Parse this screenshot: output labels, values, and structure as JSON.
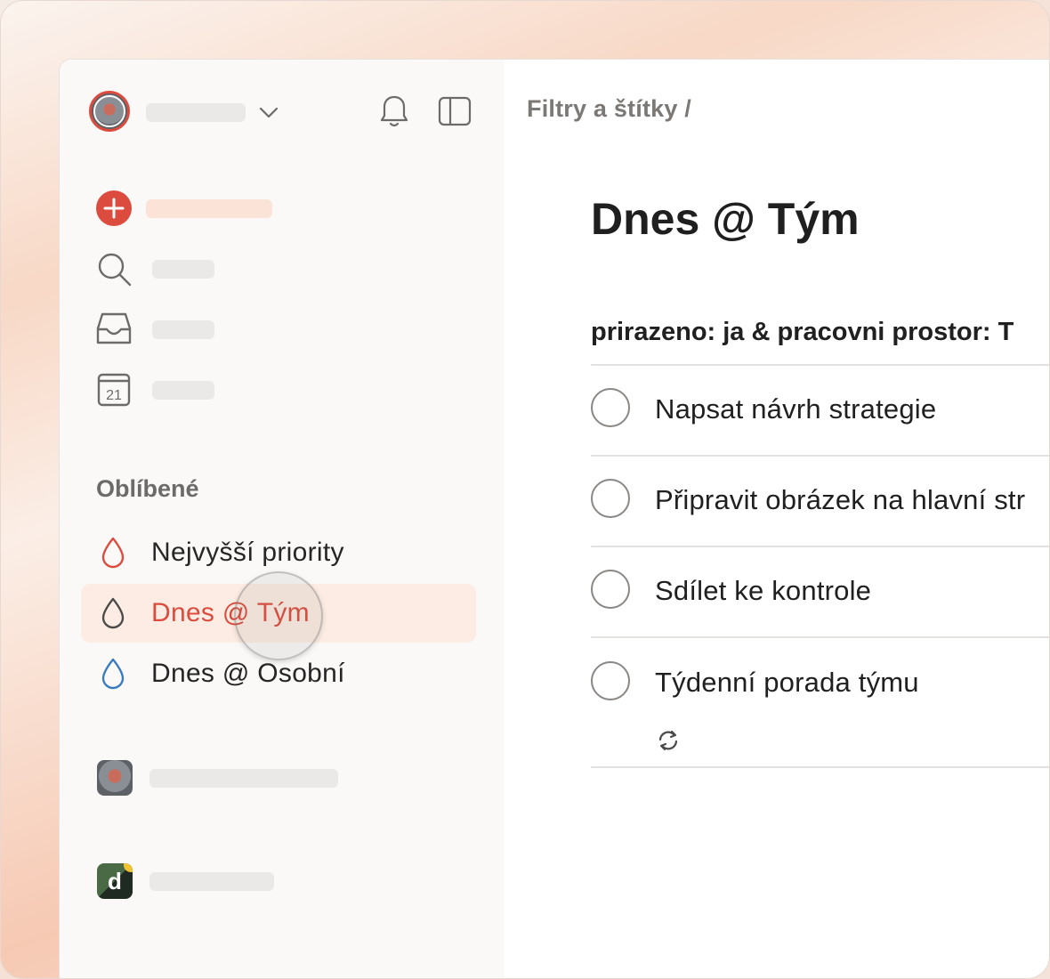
{
  "header": {
    "breadcrumb": "Filtry a štítky /"
  },
  "sidebar": {
    "favorites_title": "Oblíbené",
    "favorites": [
      {
        "label": "Nejvyšší priority",
        "color": "#dc4c3e",
        "active": false
      },
      {
        "label": "Dnes @ Tým",
        "color": "#555555",
        "active": true
      },
      {
        "label": "Dnes @ Osobní",
        "color": "#3a7bbf",
        "active": false
      }
    ],
    "nav_icons": [
      "add-task-icon",
      "search-icon",
      "inbox-icon",
      "calendar-icon"
    ],
    "calendar_day": "21",
    "workspace_letter": "d"
  },
  "main": {
    "title": "Dnes @ Tým",
    "section_header": "prirazeno: ja & pracovni prostor: T",
    "tasks": [
      {
        "text": "Napsat návrh strategie",
        "recurring": false
      },
      {
        "text": "Připravit obrázek na hlavní str",
        "recurring": false
      },
      {
        "text": "Sdílet ke kontrole",
        "recurring": false
      },
      {
        "text": "Týdenní porada týmu",
        "recurring": true
      }
    ]
  },
  "colors": {
    "accent": "#dc4c3e",
    "active_bg": "#fcece3"
  }
}
